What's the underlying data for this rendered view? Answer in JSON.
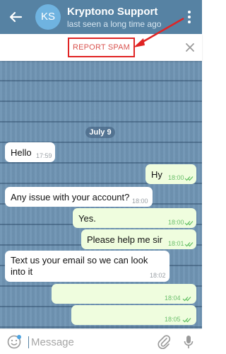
{
  "header": {
    "avatar_initials": "KS",
    "title": "Kryptono Support",
    "subtitle": "last seen a long time ago"
  },
  "spam_bar": {
    "report_label": "REPORT SPAM"
  },
  "chat": {
    "date_label": "July 9",
    "messages": [
      {
        "direction": "in",
        "text": "Hello",
        "time": "17:59"
      },
      {
        "direction": "out",
        "text": "Hy",
        "time": "18:00"
      },
      {
        "direction": "in",
        "text": "Any issue with your account?",
        "time": "18:00"
      },
      {
        "direction": "out",
        "text": "Yes.",
        "time": "18:00"
      },
      {
        "direction": "out",
        "text": "Please help me sir",
        "time": "18:01"
      },
      {
        "direction": "in",
        "text": "Text us your email so we can look into it",
        "time": "18:02"
      },
      {
        "direction": "out",
        "text": "",
        "time": "18:04"
      },
      {
        "direction": "out",
        "text": "",
        "time": "18:05"
      }
    ]
  },
  "composer": {
    "placeholder": "Message"
  },
  "colors": {
    "header_bg": "#5682a3",
    "incoming_bubble": "#ffffff",
    "outgoing_bubble": "#effdde",
    "report_spam_text": "#d9534f",
    "highlight_box": "#e02424",
    "read_check": "#5fbf5f"
  },
  "icons": {
    "back": "back-arrow-icon",
    "more": "more-vertical-icon",
    "close": "close-icon",
    "emoji": "smiley-icon",
    "attach": "paperclip-icon",
    "voice": "microphone-icon"
  }
}
